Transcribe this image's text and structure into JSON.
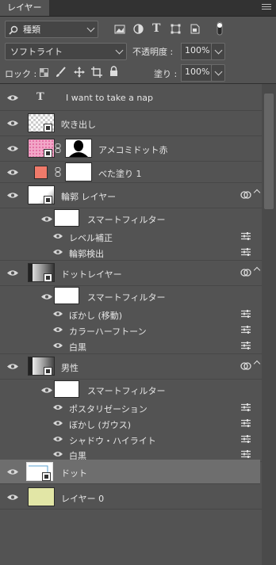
{
  "panel": {
    "tab": "レイヤー"
  },
  "filter": {
    "kind": "種類"
  },
  "blend": {
    "mode": "ソフトライト",
    "opacity_label": "不透明度 :",
    "opacity": "100%"
  },
  "lock": {
    "label": "ロック :",
    "fill_label": "塗り :",
    "fill": "100%"
  },
  "layers": [
    {
      "name": "I want to  take a nap",
      "type": "text"
    },
    {
      "name": "吹き出し"
    },
    {
      "name": "アメコミドット赤"
    },
    {
      "name": "べた塗り 1"
    },
    {
      "name": "輪郭 レイヤー"
    },
    {
      "name": "スマートフィルター"
    },
    {
      "name": "レベル補正"
    },
    {
      "name": "輪郭検出"
    },
    {
      "name": "ドットレイヤー"
    },
    {
      "name": "スマートフィルター"
    },
    {
      "name": "ぼかし (移動)"
    },
    {
      "name": "カラーハーフトーン"
    },
    {
      "name": "白黒"
    },
    {
      "name": "男性"
    },
    {
      "name": "スマートフィルター"
    },
    {
      "name": "ポスタリゼーション"
    },
    {
      "name": "ぼかし (ガウス)"
    },
    {
      "name": "シャドウ・ハイライト"
    },
    {
      "name": "白黒"
    },
    {
      "name": "ドット"
    },
    {
      "name": "レイヤー 0"
    }
  ],
  "colors": {
    "accent_fill": "#f07a6a",
    "layer0_fill": "#e2e6a6",
    "pink": "#f2a7c8"
  }
}
